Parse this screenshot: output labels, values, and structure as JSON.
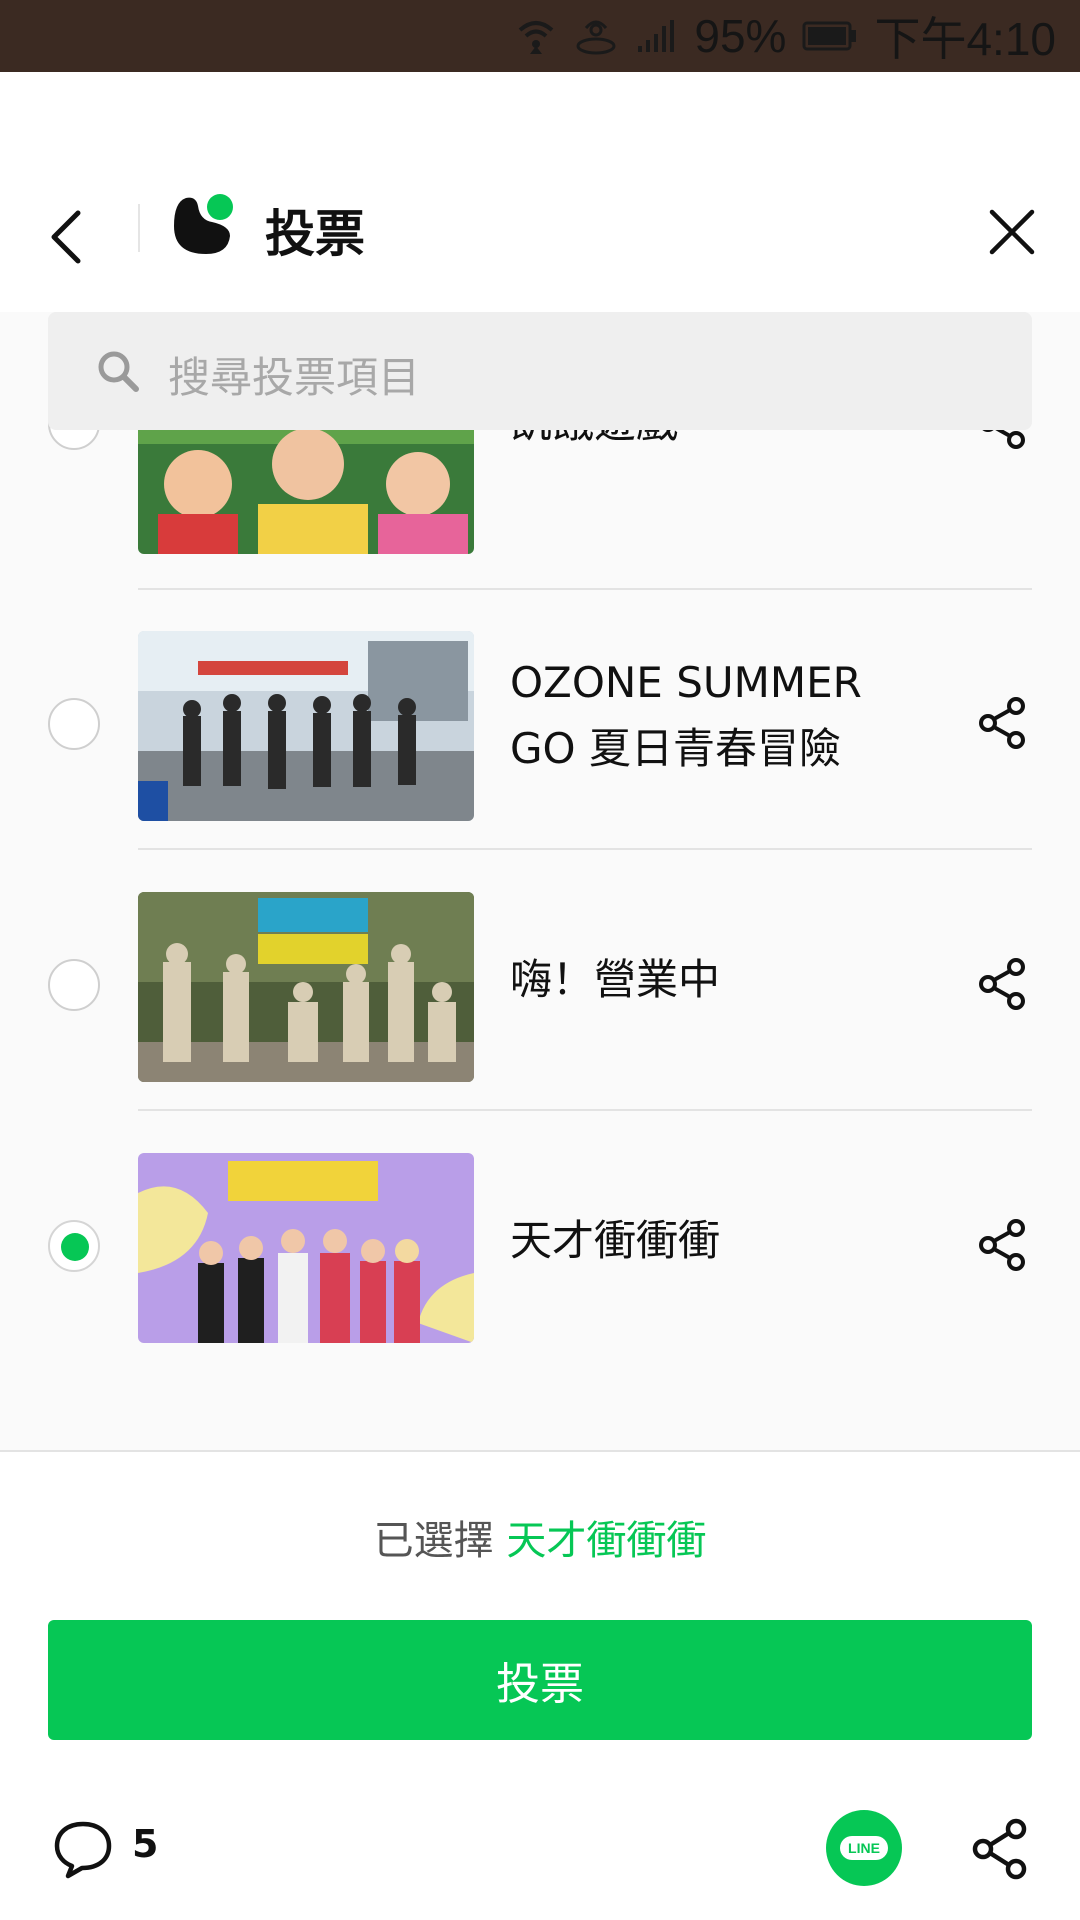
{
  "status_bar": {
    "battery": "95%",
    "time": "下午4:10",
    "icons": [
      "wifi-icon",
      "hotspot-icon",
      "signal-icon",
      "battery-icon"
    ]
  },
  "header": {
    "title": "投票",
    "icons": [
      "back-icon",
      "app-logo-icon",
      "close-icon"
    ]
  },
  "search": {
    "placeholder": "搜尋投票項目"
  },
  "items": [
    {
      "title": "飢餓遊戲",
      "selected": false
    },
    {
      "title_line1": "OZONE SUMMER",
      "title_line2": "GO 夏日青春冒險",
      "selected": false
    },
    {
      "title": "嗨！營業中",
      "selected": false
    },
    {
      "title": "天才衝衝衝",
      "selected": true
    }
  ],
  "footer": {
    "selected_prefix": "已選擇",
    "selected_value": "天才衝衝衝",
    "vote_button": "投票"
  },
  "bottom_bar": {
    "comment_count": "5",
    "line_label": "LINE"
  },
  "colors": {
    "accent": "#06c755",
    "status_bar_bg": "#3b2a22",
    "content_bg": "#fafafa"
  }
}
